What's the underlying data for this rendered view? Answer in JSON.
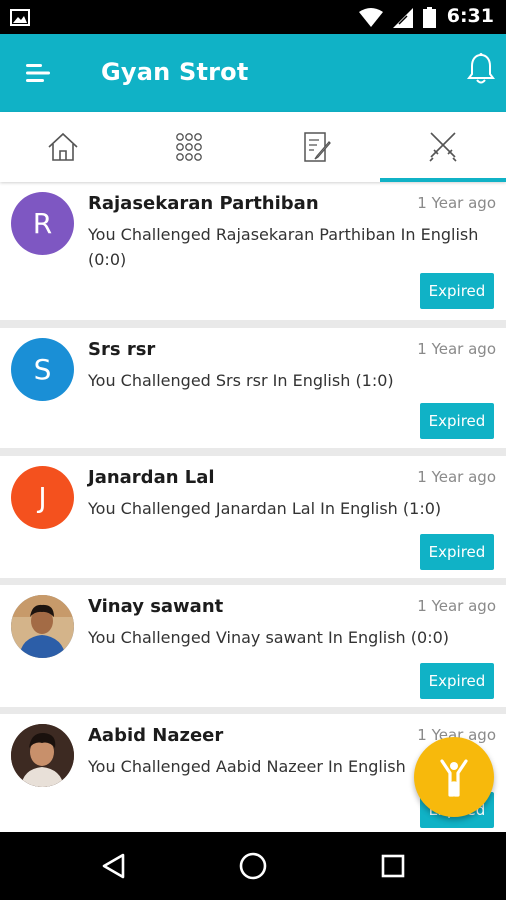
{
  "status_bar": {
    "time": "6:31"
  },
  "app_bar": {
    "title": "Gyan Strot"
  },
  "tabs": [
    {
      "name": "home",
      "icon": "home-icon"
    },
    {
      "name": "categories",
      "icon": "grid-icon"
    },
    {
      "name": "quiz",
      "icon": "document-edit-icon"
    },
    {
      "name": "challenges",
      "icon": "crossed-swords-icon",
      "selected": true
    }
  ],
  "challenges": [
    {
      "initial": "R",
      "avatar_color": "#7e57c2",
      "name": "Rajasekaran Parthiban",
      "time": "1 Year ago",
      "description": "You Challenged Rajasekaran Parthiban In English (0:0)",
      "status": "Expired"
    },
    {
      "initial": "S",
      "avatar_color": "#1a8fd6",
      "name": "Srs rsr",
      "time": "1 Year ago",
      "description": "You Challenged Srs rsr In English (1:0)",
      "status": "Expired"
    },
    {
      "initial": "J",
      "avatar_color": "#f4511e",
      "name": "Janardan Lal",
      "time": "1 Year ago",
      "description": "You Challenged Janardan Lal In English (1:0)",
      "status": "Expired"
    },
    {
      "initial": "",
      "avatar_color": "#3a5a8a",
      "name": "Vinay sawant",
      "time": "1 Year ago",
      "description": "You Challenged Vinay sawant In English (0:0)",
      "status": "Expired"
    },
    {
      "initial": "",
      "avatar_color": "#5a3b2e",
      "name": "Aabid Nazeer",
      "time": "1 Year ago",
      "description": "You Challenged Aabid Nazeer In English",
      "status": "Expired"
    }
  ],
  "colors": {
    "accent": "#10b2c6",
    "fab": "#f7b90c"
  }
}
